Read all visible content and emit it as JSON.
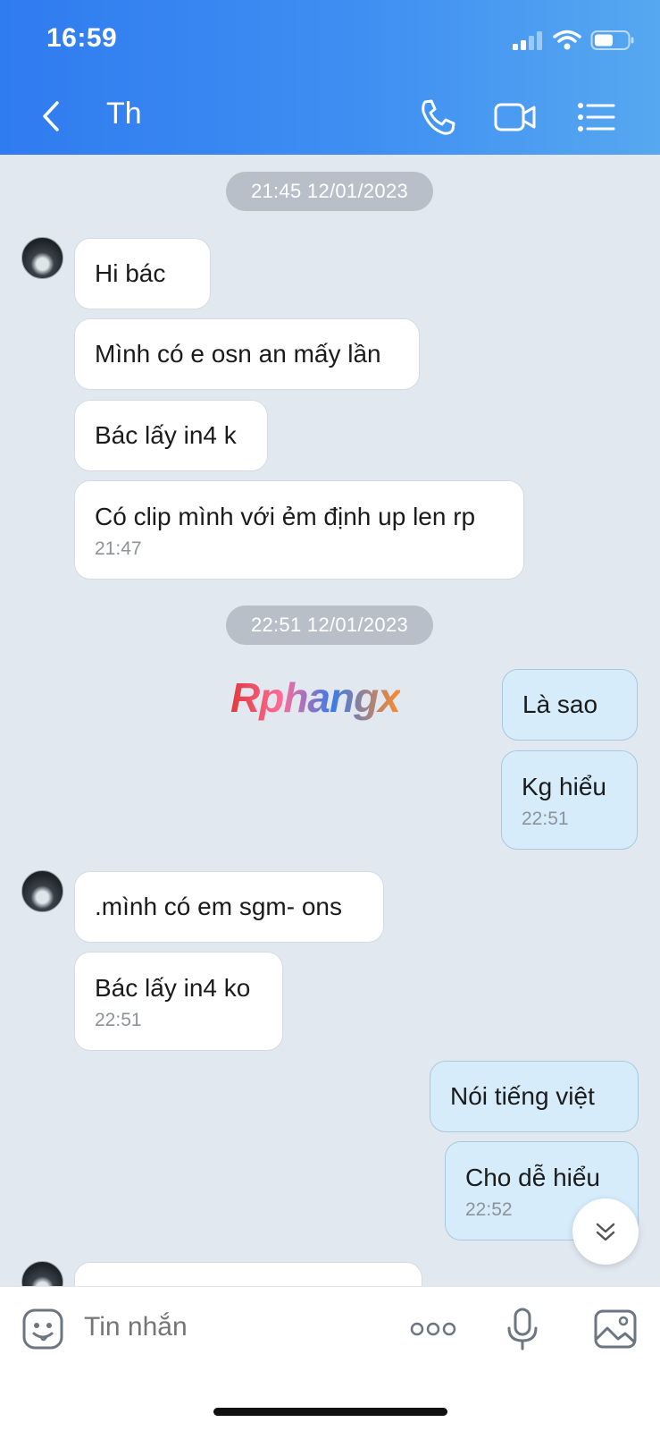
{
  "status_bar": {
    "time": "16:59"
  },
  "nav": {
    "title": "Th"
  },
  "date_pills": [
    "21:45 12/01/2023",
    "22:51 12/01/2023"
  ],
  "messages": [
    {
      "text": "Hi bác"
    },
    {
      "text": "Mình có e osn an mấy lần"
    },
    {
      "text": "Bác lấy in4 k"
    },
    {
      "text": "Có clip mình với ẻm định up len rp",
      "time": "21:47"
    },
    {
      "text": "Là sao"
    },
    {
      "text": "Kg hiểu",
      "time": "22:51"
    },
    {
      "text": ".mình có em sgm- ons"
    },
    {
      "text": "Bác lấy in4 ko",
      "time": "22:51"
    },
    {
      "text": "Nói tiếng việt"
    },
    {
      "text": "Cho dễ hiểu",
      "time": "22:52"
    }
  ],
  "watermark": "Rphangx",
  "composer": {
    "placeholder": "Tin nhắn"
  },
  "colors": {
    "header_accent": "#3f8ff2",
    "outgoing_bubble": "#d6ecfb",
    "incoming_bubble": "#ffffff"
  }
}
